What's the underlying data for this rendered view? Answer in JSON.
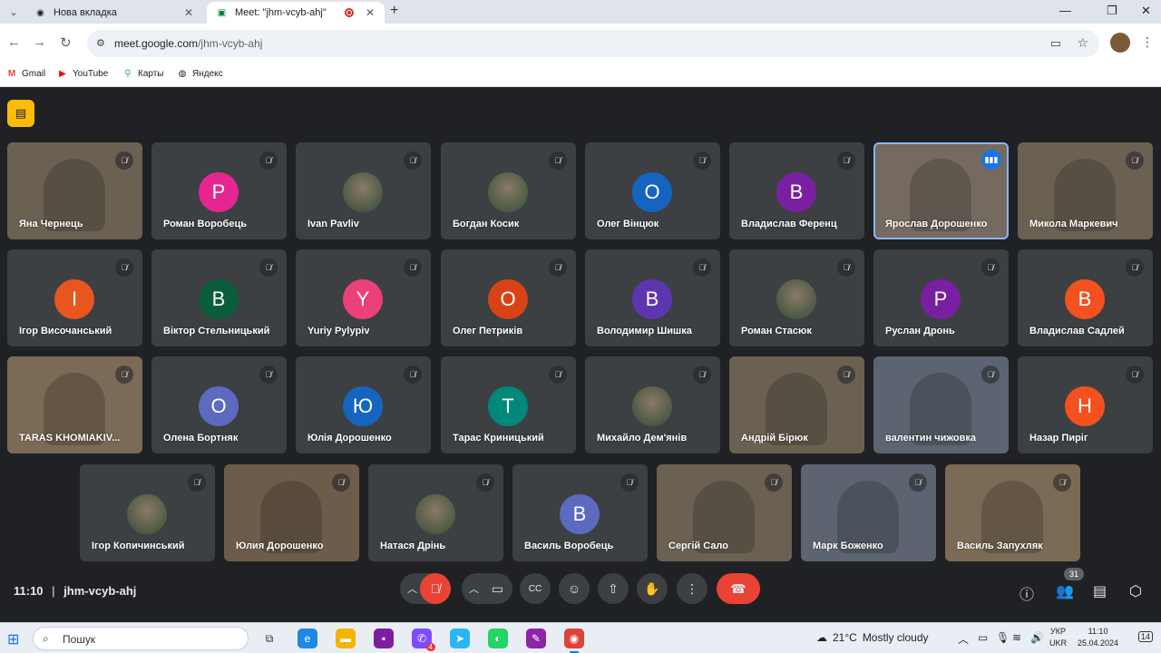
{
  "browser": {
    "tabs": [
      {
        "title": "Нова вкладка",
        "favicon": "chrome-icon"
      },
      {
        "title": "Meet: \"jhm-vcyb-ahj\"",
        "favicon": "meet-icon"
      }
    ],
    "url_host": "meet.google.com",
    "url_path": "/jhm-vcyb-ahj",
    "bookmarks": [
      {
        "label": "Gmail",
        "icon": "gmail-icon",
        "color": "#ea4335"
      },
      {
        "label": "YouTube",
        "icon": "youtube-icon",
        "color": "#ff0000"
      },
      {
        "label": "Карты",
        "icon": "maps-pin-icon",
        "color": "#34a853"
      },
      {
        "label": "Яндекс",
        "icon": "yandex-icon",
        "color": "#222222"
      }
    ]
  },
  "meet": {
    "participants": [
      {
        "name": "Яна Чернець",
        "mode": "video"
      },
      {
        "name": "Роман Воробець",
        "initial": "Р",
        "color": "#e52592"
      },
      {
        "name": "Ivan Pavliv",
        "mode": "photo"
      },
      {
        "name": "Богдан Косик",
        "mode": "photo"
      },
      {
        "name": "Олег Вінцюк",
        "initial": "О",
        "color": "#1565c0"
      },
      {
        "name": "Владислав Ференц",
        "initial": "В",
        "color": "#7b1fa2"
      },
      {
        "name": "Ярослав Дорошенко",
        "mode": "video",
        "speaking": true
      },
      {
        "name": "Микола Маркевич",
        "mode": "video"
      },
      {
        "name": "Ігор Височанський",
        "initial": "І",
        "color": "#e8561f"
      },
      {
        "name": "Віктор Стельницький",
        "initial": "В",
        "color": "#0b5d3b"
      },
      {
        "name": "Yuriy Pylypiv",
        "initial": "Y",
        "color": "#ec407a"
      },
      {
        "name": "Олег Петриків",
        "initial": "О",
        "color": "#d84315"
      },
      {
        "name": "Володимир Шишка",
        "initial": "В",
        "color": "#5e35b1"
      },
      {
        "name": "Роман Стасюк",
        "mode": "photo"
      },
      {
        "name": "Руслан Дронь",
        "initial": "Р",
        "color": "#7b1fa2"
      },
      {
        "name": "Владислав Садлей",
        "initial": "В",
        "color": "#f4511e"
      },
      {
        "name": "TARAS KHOMIAKIV...",
        "mode": "video"
      },
      {
        "name": "Олена Бортняк",
        "initial": "О",
        "color": "#5c6bc0"
      },
      {
        "name": "Юлія Дорошенко",
        "initial": "Ю",
        "color": "#1565c0"
      },
      {
        "name": "Тарас Криницький",
        "initial": "Т",
        "color": "#00897b"
      },
      {
        "name": "Михайло Дем'янів",
        "mode": "photo"
      },
      {
        "name": "Андрій Бірюк",
        "mode": "video"
      },
      {
        "name": "валентин чижовка",
        "mode": "video"
      },
      {
        "name": "Назар Пиріг",
        "initial": "Н",
        "color": "#f4511e"
      },
      {
        "name": "Ігор Копичинський",
        "mode": "photo"
      },
      {
        "name": "Юлия Дорошенко",
        "mode": "video"
      },
      {
        "name": "Натаcя Дрінь",
        "mode": "photo"
      },
      {
        "name": "Василь Воробець",
        "initial": "В",
        "color": "#5c6bc0"
      },
      {
        "name": "Сергій Сало",
        "mode": "video"
      },
      {
        "name": "Марк Боженко",
        "mode": "video"
      },
      {
        "name": "Василь Запухляк",
        "mode": "video"
      }
    ],
    "time": "11:10",
    "separator": "|",
    "meeting_code": "jhm-vcyb-ahj",
    "participant_count": "31"
  },
  "taskbar": {
    "search_label": "Пошук",
    "weather_temp": "21°C",
    "weather_text": "Mostly cloudy",
    "lang_top": "УКР",
    "lang_bottom": "UKR",
    "clock_time": "11:10",
    "clock_date": "25.04.2024",
    "notifications": "14",
    "viber_badge": "4"
  }
}
